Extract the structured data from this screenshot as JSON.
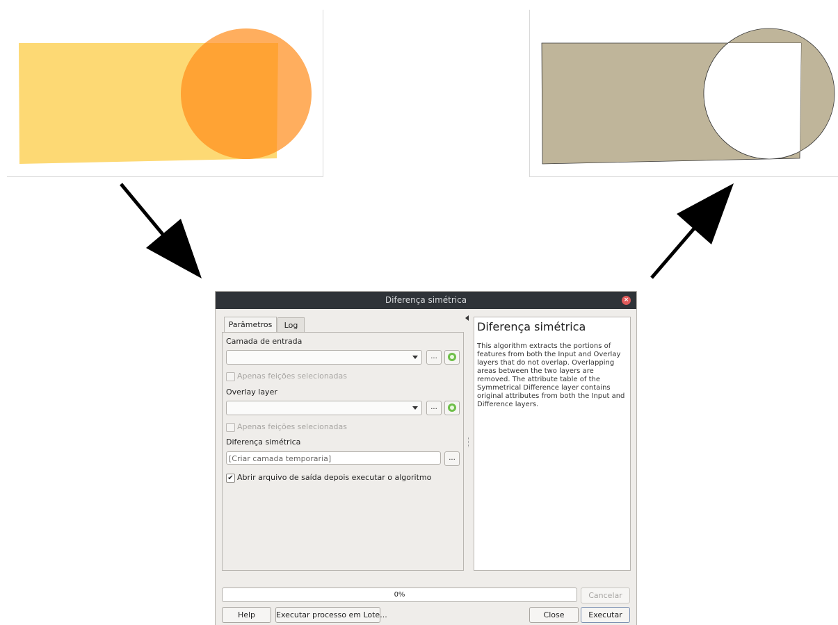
{
  "dialog": {
    "title": "Diferença simétrica",
    "tabs": [
      {
        "label": "Parâmetros",
        "active": true
      },
      {
        "label": "Log",
        "active": false
      }
    ],
    "params": {
      "input_layer_label": "Camada de entrada",
      "input_layer_value": "",
      "selected_only_label_1": "Apenas feições selecionadas",
      "overlay_layer_label": "Overlay layer",
      "overlay_layer_value": "",
      "selected_only_label_2": "Apenas feições selecionadas",
      "output_label": "Diferença simétrica",
      "output_placeholder": "[Criar camada temporaria]",
      "open_output_label": "Abrir arquivo de saída depois executar o algoritmo",
      "open_output_checked": true,
      "browse_label": "..."
    },
    "help": {
      "title": "Diferença simétrica",
      "body": "This algorithm extracts the portions of features from both the Input and Overlay layers that do not overlap. Overlapping areas between the two layers are removed. The attribute table of the Symmetrical Difference layer contains original attributes from both the Input and Difference layers."
    },
    "progress": {
      "text": "0%",
      "value": 0
    },
    "buttons": {
      "cancel": "Cancelar",
      "help": "Help",
      "batch": "Executar processo em Lote...",
      "close": "Close",
      "run": "Executar"
    }
  },
  "colors": {
    "rect_fill": "#fdd974",
    "circle_fill": "#ff9c33",
    "result_fill": "#bfb59a",
    "titlebar": "#2f3338"
  }
}
